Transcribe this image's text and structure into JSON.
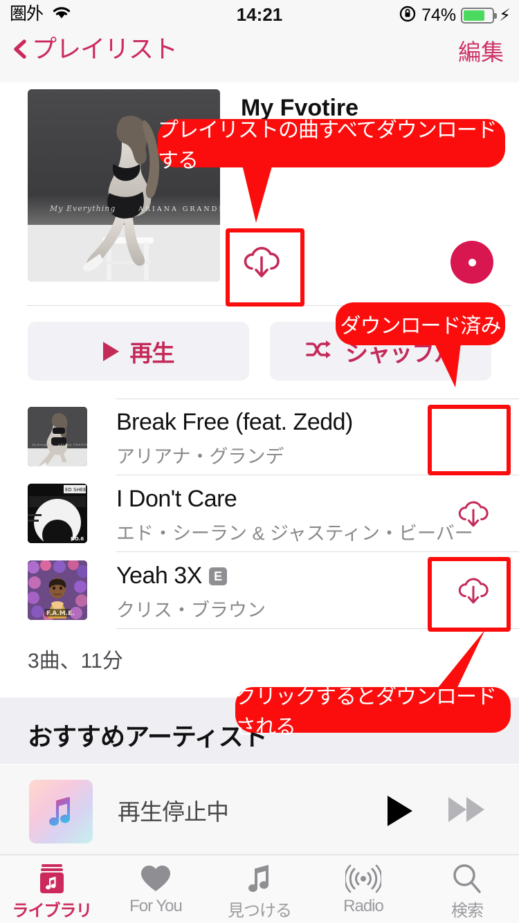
{
  "status_bar": {
    "carrier": "圏外",
    "wifi_icon": "wifi-icon",
    "time": "14:21",
    "rotation_lock_icon": "rotation-lock-icon",
    "battery_percent": "74%",
    "battery_level": 74,
    "charging_icon": "lightning-bolt-icon"
  },
  "nav_bar": {
    "back_icon": "chevron-left-icon",
    "back_label": "プレイリスト",
    "edit_label": "編集"
  },
  "header": {
    "playlist_title": "My Fvotire",
    "artwork_name": "album-artwork-my-everything",
    "download_all_icon": "cloud-download-icon",
    "more_icon": "ellipsis-icon"
  },
  "actions": {
    "play_label": "再生",
    "play_icon": "play-triangle-icon",
    "shuffle_label": "シャッフル",
    "shuffle_icon": "shuffle-icon"
  },
  "tracks": [
    {
      "title": "Break Free (feat. Zedd)",
      "artist": "アリアナ・グランデ",
      "explicit": false,
      "downloaded": true,
      "cloud_icon": ""
    },
    {
      "title": "I Don't Care",
      "artist": "エド・シーラン & ジャスティン・ビーバー",
      "explicit": false,
      "downloaded": false,
      "cloud_icon": "cloud-download-icon"
    },
    {
      "title": "Yeah 3X",
      "explicit_badge": "E",
      "artist": "クリス・ブラウン",
      "explicit": true,
      "downloaded": false,
      "cloud_icon": "cloud-download-icon"
    }
  ],
  "summary": "3曲、11分",
  "section": {
    "title": "おすすめアーティスト"
  },
  "mini_player": {
    "status": "再生停止中",
    "artwork_icon": "apple-music-note-icon",
    "play_icon": "play-triangle-icon",
    "forward_icon": "fast-forward-icon"
  },
  "tab_bar": {
    "items": [
      {
        "label": "ライブラリ",
        "icon": "library-icon",
        "active": true
      },
      {
        "label": "For You",
        "icon": "heart-icon",
        "active": false
      },
      {
        "label": "見つける",
        "icon": "music-note-icon",
        "active": false
      },
      {
        "label": "Radio",
        "icon": "radio-broadcast-icon",
        "active": false
      },
      {
        "label": "検索",
        "icon": "search-icon",
        "active": false
      }
    ]
  },
  "annotations": {
    "bubbles": [
      {
        "text": "プレイリストの曲すべてダウンロードする"
      },
      {
        "text": "ダウンロード済み"
      },
      {
        "text": "クリックするとダウンロードされる"
      }
    ],
    "color": "#fb0d0d"
  },
  "colors": {
    "accent": "#cc2a5d",
    "annotation_red": "#fb0d0d",
    "more_button": "#d8164f",
    "battery_green": "#4cd95f"
  }
}
